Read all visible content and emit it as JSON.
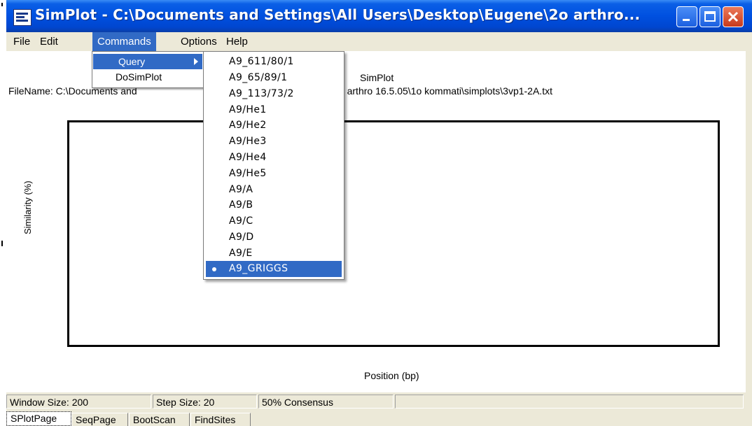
{
  "window": {
    "title": "SimPlot - C:\\Documents and Settings\\All Users\\Desktop\\Eugene\\2o arthro...",
    "titlebar_color": "#0054e3",
    "accent": "#316ac5"
  },
  "menubar": {
    "items": [
      "File",
      "Edit",
      "Commands",
      "Options",
      "Help"
    ],
    "active": "Commands"
  },
  "commands_menu": {
    "items": [
      "Query",
      "DoSimPlot"
    ],
    "highlighted": "Query",
    "submenu_arrow": "right-arrow-icon"
  },
  "query_submenu": {
    "items": [
      "A9_611/80/1",
      "A9_65/89/1",
      "A9_113/73/2",
      "A9/He1",
      "A9/He2",
      "A9/He3",
      "A9/He4",
      "A9/He5",
      "A9/A",
      "A9/B",
      "A9/C",
      "A9/D",
      "A9/E",
      "A9_GRIGGS"
    ],
    "selected": "A9_GRIGGS"
  },
  "plot": {
    "title": "SimPlot",
    "filename_prefix": "FileName: C:\\Documents and",
    "filename_suffix": "ktop\\Eugene\\2o arthro 16.5.05\\1o kommati\\simplots\\3vp1-2A.txt",
    "ylabel": "Similarity (%)",
    "xlabel": "Position (bp)"
  },
  "statusbar": {
    "window_size": "Window Size: 200",
    "step_size": "Step Size: 20",
    "consensus": "50% Consensus"
  },
  "tabs": {
    "items": [
      "SPlotPage",
      "SeqPage",
      "BootScan",
      "FindSites"
    ],
    "active": "SPlotPage"
  }
}
